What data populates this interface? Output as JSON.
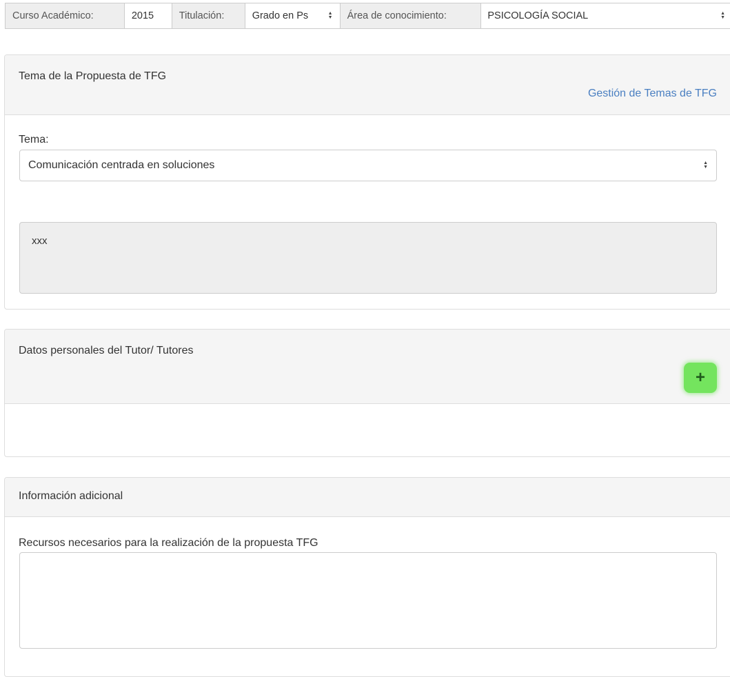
{
  "filter_bar": {
    "curso_label": "Curso Académico:",
    "curso_value": "2015",
    "titulacion_label": "Titulación:",
    "titulacion_value": "Grado en Ps",
    "area_label": "Área de conocimiento:",
    "area_value": "PSICOLOGÍA SOCIAL"
  },
  "tema_panel": {
    "title": "Tema de la Propuesta de TFG",
    "link": "Gestión de Temas de TFG",
    "tema_label": "Tema:",
    "tema_value": "Comunicación centrada en soluciones",
    "description": "xxx"
  },
  "tutor_panel": {
    "title": "Datos personales del Tutor/ Tutores",
    "add_button_label": "+",
    "add_button_color": "#74e45e"
  },
  "info_panel": {
    "title": "Información adicional",
    "recursos_label": "Recursos necesarios para la realización de la propuesta TFG",
    "recursos_value": ""
  },
  "icons": {
    "select_arrows": "up-down-chevron-icon",
    "add": "plus-icon"
  },
  "colors": {
    "link": "#4a7fc1",
    "panel_heading_bg": "#f5f5f5",
    "addon_bg": "#eeeeee"
  }
}
